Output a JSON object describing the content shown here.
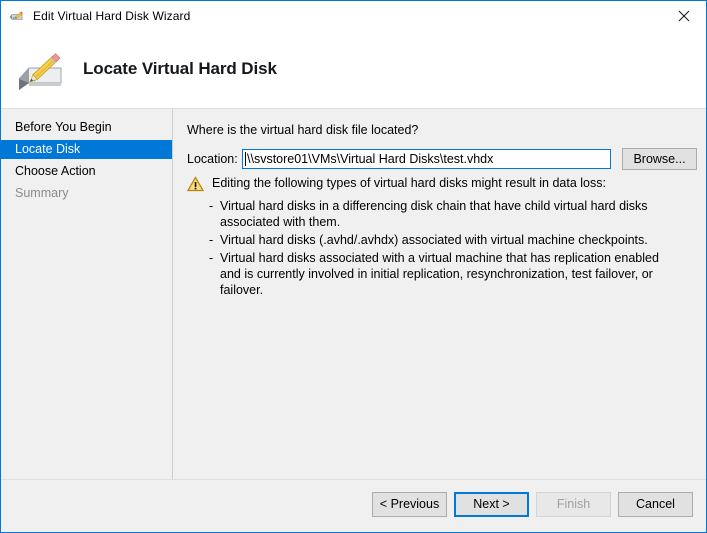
{
  "window": {
    "title": "Edit Virtual Hard Disk Wizard",
    "title_icon": "edit-vhd-icon",
    "close_icon": "close-icon",
    "accent_color": "#0078d7"
  },
  "header": {
    "icon": "vhd-pencil-icon",
    "title": "Locate Virtual Hard Disk"
  },
  "sidebar": {
    "items": [
      {
        "label": "Before You Begin",
        "state": "normal"
      },
      {
        "label": "Locate Disk",
        "state": "selected"
      },
      {
        "label": "Choose Action",
        "state": "normal"
      },
      {
        "label": "Summary",
        "state": "disabled"
      }
    ]
  },
  "main": {
    "prompt": "Where is the virtual hard disk file located?",
    "location_label": "Location:",
    "location_value": "\\\\svstore01\\VMs\\Virtual Hard Disks\\test.vhdx",
    "location_placeholder": "",
    "browse_label": "Browse...",
    "warning": {
      "icon": "warning-triangle-icon",
      "heading": "Editing the following types of virtual hard disks might result in data loss:",
      "bullet_marker": "-",
      "items": [
        "Virtual hard disks in a differencing disk chain that have child virtual hard disks associated with them.",
        "Virtual hard disks (.avhd/.avhdx) associated with virtual machine checkpoints.",
        "Virtual hard disks associated with a virtual machine that has replication enabled and is currently involved in initial replication, resynchronization, test failover, or failover."
      ]
    }
  },
  "footer": {
    "buttons": [
      {
        "label": "< Previous",
        "state": "normal"
      },
      {
        "label": "Next >",
        "state": "focused"
      },
      {
        "label": "Finish",
        "state": "disabled"
      },
      {
        "label": "Cancel",
        "state": "normal"
      }
    ]
  }
}
